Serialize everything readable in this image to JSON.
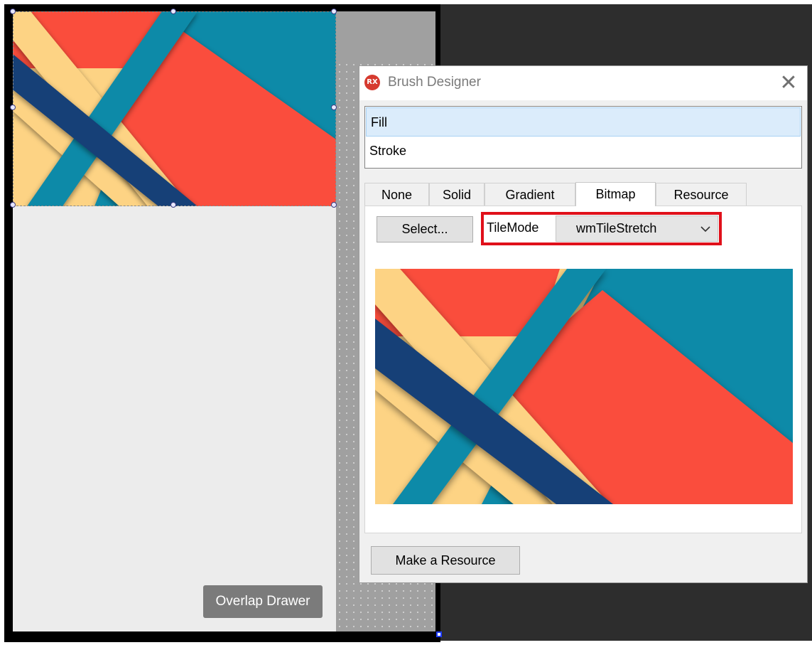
{
  "form": {
    "overlap_button": "Overlap Drawer"
  },
  "dialog": {
    "logo_text": "RX",
    "title": "Brush Designer",
    "close_glyph": "✕",
    "targets": [
      "Fill",
      "Stroke"
    ],
    "selected_target": "Fill",
    "tabs": [
      "None",
      "Solid",
      "Gradient",
      "Bitmap",
      "Resource"
    ],
    "active_tab": "Bitmap",
    "select_button": "Select...",
    "tilemode_label": "TileMode",
    "tilemode_value": "wmTileStretch",
    "make_resource_button": "Make a Resource"
  },
  "colors": {
    "image_teal": "#0e8aa8",
    "image_red": "#fa4d3c",
    "image_yellow": "#fdd384",
    "image_navy": "#143f77",
    "highlight_red": "#e0101a",
    "selection_blue": "#dbecfb"
  },
  "icons": {
    "close": "close-icon",
    "dropdown": "chevron-down-icon",
    "logo": "rx-logo-icon"
  }
}
